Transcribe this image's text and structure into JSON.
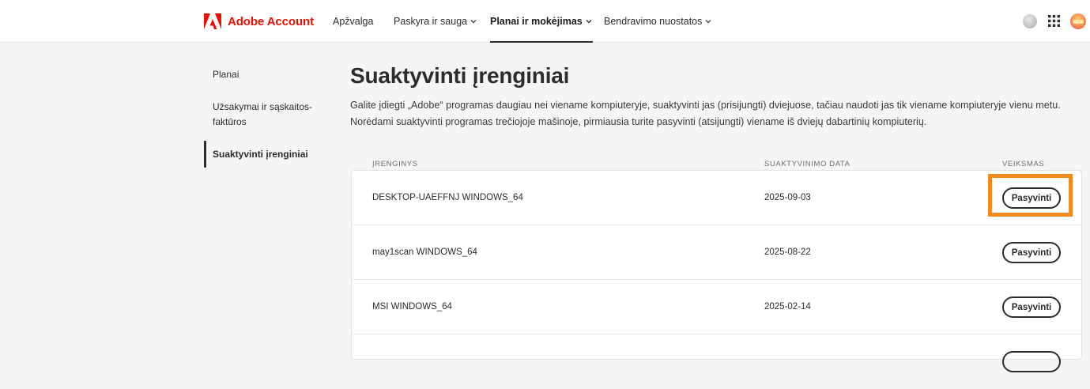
{
  "header": {
    "brand": "Adobe Account",
    "nav": [
      {
        "label": "Apžvalga",
        "dropdown": false,
        "active": false
      },
      {
        "label": "Paskyra ir sauga",
        "dropdown": true,
        "active": false
      },
      {
        "label": "Planai ir mokėjimas",
        "dropdown": true,
        "active": true
      },
      {
        "label": "Bendravimo nuostatos",
        "dropdown": true,
        "active": false
      }
    ],
    "right_icons": [
      "status-circle-icon",
      "app-grid-icon",
      "user-avatar-icon"
    ]
  },
  "sidebar": {
    "items": [
      {
        "label": "Planai",
        "active": false
      },
      {
        "label": "Užsakymai ir sąskaitos-faktūros",
        "active": false
      },
      {
        "label": "Suaktyvinti įrenginiai",
        "active": true
      }
    ]
  },
  "main": {
    "title": "Suaktyvinti įrenginiai",
    "description": "Galite įdiegti „Adobe“ programas daugiau nei viename kompiuteryje, suaktyvinti jas (prisijungti) dviejuose, tačiau naudoti jas tik viename kompiuteryje vienu metu. Norėdami suaktyvinti programas trečiojoje mašinoje, pirmiausia turite pasyvinti (atsijungti) viename iš dviejų dabartinių kompiuterių.",
    "table": {
      "headers": [
        "ĮRENGINYS",
        "SUAKTYVINIMO DATA",
        "VEIKSMAS"
      ],
      "rows": [
        {
          "device": "DESKTOP-UAEFFNJ WINDOWS_64",
          "date": "2025-09-03",
          "action": "Pasyvinti"
        },
        {
          "device": "may1scan WINDOWS_64",
          "date": "2025-08-22",
          "action": "Pasyvinti"
        },
        {
          "device": "MSI WINDOWS_64",
          "date": "2025-02-14",
          "action": "Pasyvinti"
        }
      ]
    }
  },
  "colors": {
    "brand_red": "#eb1000",
    "highlight": "#f28a1e",
    "text": "#2c2c2c",
    "background": "#f5f5f5"
  }
}
